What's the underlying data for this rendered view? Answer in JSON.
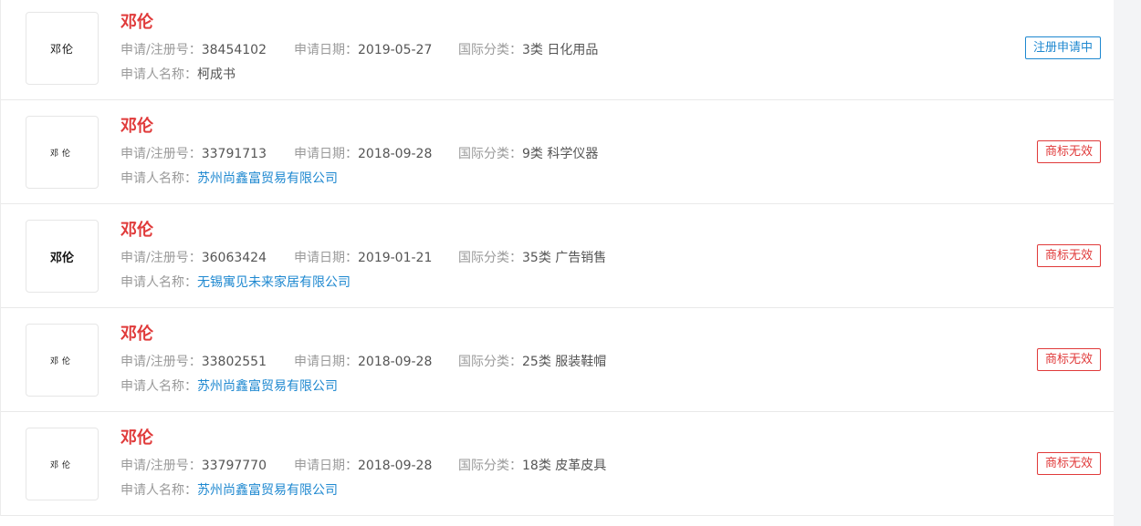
{
  "labels": {
    "reg_no": "申请/注册号：",
    "apply_date": "申请日期：",
    "intl_class": "国际分类：",
    "applicant": "申请人名称："
  },
  "colors": {
    "name": "#e03a3a",
    "link": "#1e88d0",
    "status_pending": "#1e88d0",
    "status_invalid": "#e03a3a"
  },
  "items": [
    {
      "logo_text": "邓伦",
      "name": "邓伦",
      "reg_no": "38454102",
      "apply_date": "2019-05-27",
      "intl_class": "3类 日化用品",
      "applicant": "柯成书",
      "applicant_is_link": false,
      "status": "注册申请中",
      "status_type": "pending"
    },
    {
      "logo_text": "邓伦",
      "name": "邓伦",
      "reg_no": "33791713",
      "apply_date": "2018-09-28",
      "intl_class": "9类 科学仪器",
      "applicant": "苏州尚鑫富贸易有限公司",
      "applicant_is_link": true,
      "status": "商标无效",
      "status_type": "invalid"
    },
    {
      "logo_text": "邓伦",
      "name": "邓伦",
      "reg_no": "36063424",
      "apply_date": "2019-01-21",
      "intl_class": "35类 广告销售",
      "applicant": "无锡寓见未来家居有限公司",
      "applicant_is_link": true,
      "status": "商标无效",
      "status_type": "invalid"
    },
    {
      "logo_text": "邓伦",
      "name": "邓伦",
      "reg_no": "33802551",
      "apply_date": "2018-09-28",
      "intl_class": "25类 服装鞋帽",
      "applicant": "苏州尚鑫富贸易有限公司",
      "applicant_is_link": true,
      "status": "商标无效",
      "status_type": "invalid"
    },
    {
      "logo_text": "邓伦",
      "name": "邓伦",
      "reg_no": "33797770",
      "apply_date": "2018-09-28",
      "intl_class": "18类 皮革皮具",
      "applicant": "苏州尚鑫富贸易有限公司",
      "applicant_is_link": true,
      "status": "商标无效",
      "status_type": "invalid"
    }
  ]
}
